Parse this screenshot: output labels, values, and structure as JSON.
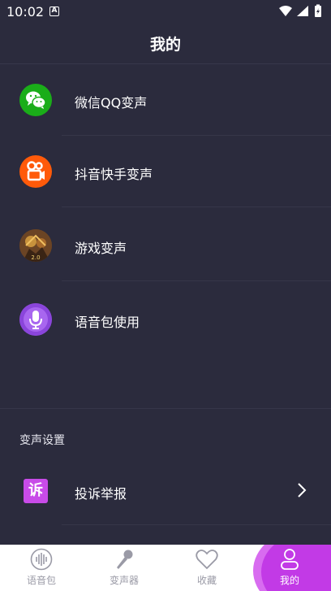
{
  "status_bar": {
    "time": "10:02",
    "notif_letter": "A"
  },
  "header": {
    "title": "我的"
  },
  "menu": [
    {
      "label": "微信QQ变声",
      "icon": "wechat-icon"
    },
    {
      "label": "抖音快手变声",
      "icon": "kuaishou-icon"
    },
    {
      "label": "游戏变声",
      "icon": "game-avatar-icon"
    },
    {
      "label": "语音包使用",
      "icon": "microphone-icon"
    }
  ],
  "settings": {
    "section_title": "变声设置",
    "items": [
      {
        "label": "投诉举报",
        "icon_text": "诉"
      }
    ]
  },
  "tabbar": {
    "tabs": [
      {
        "label": "语音包",
        "icon": "soundwave-icon",
        "active": false
      },
      {
        "label": "变声器",
        "icon": "microphone-icon",
        "active": false
      },
      {
        "label": "收藏",
        "icon": "heart-icon",
        "active": false
      },
      {
        "label": "我的",
        "icon": "person-icon",
        "active": true
      }
    ]
  },
  "colors": {
    "background": "#2b2b3d",
    "accent": "#c23ae6",
    "wechat": "#1aad19",
    "kuaishou": "#ff5a0a",
    "mic_purple": "#9b4fe3"
  }
}
